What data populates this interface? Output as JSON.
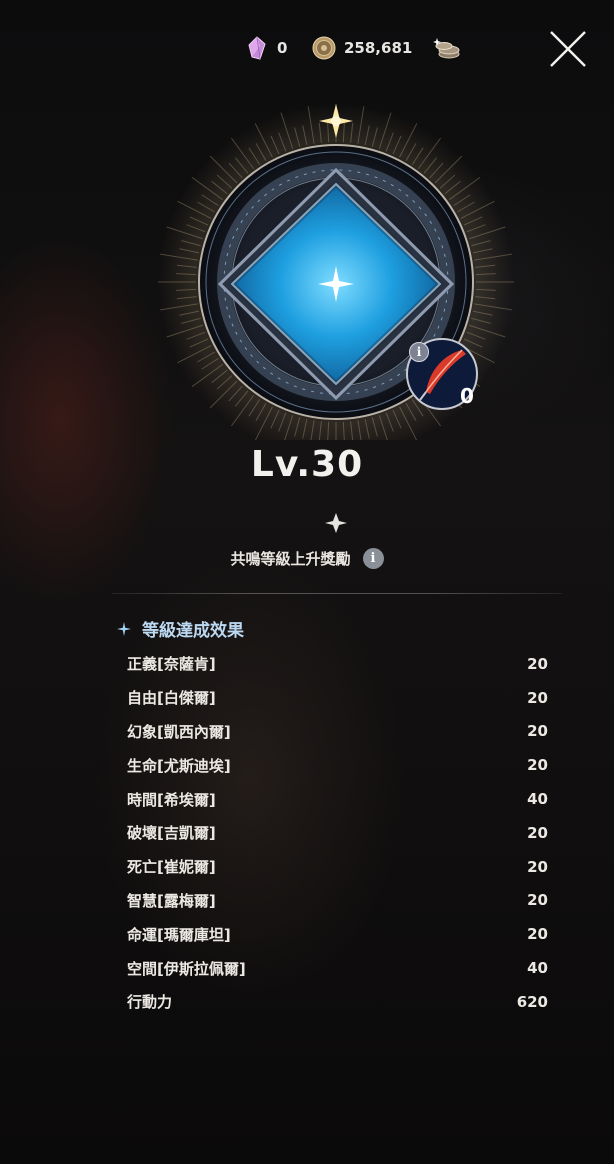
{
  "currencies": [
    {
      "icon": "crystal-icon",
      "value": "0"
    },
    {
      "icon": "coin-icon",
      "value": "258,681"
    },
    {
      "icon": "coin-stack-icon"
    }
  ],
  "emblem": {
    "feather_count": "0",
    "info_glyph": "i"
  },
  "level": "Lv.30",
  "reward": {
    "label": "共鳴等級上升獎勵",
    "info_glyph": "i"
  },
  "effects_title": "等級達成效果",
  "effects": [
    {
      "name": "正義[奈薩肯]",
      "value": "20"
    },
    {
      "name": "自由[白傑爾]",
      "value": "20"
    },
    {
      "name": "幻象[凱西內爾]",
      "value": "20"
    },
    {
      "name": "生命[尤斯迪埃]",
      "value": "20"
    },
    {
      "name": "時間[希埃爾]",
      "value": "40"
    },
    {
      "name": "破壞[吉凱爾]",
      "value": "20"
    },
    {
      "name": "死亡[崔妮爾]",
      "value": "20"
    },
    {
      "name": "智慧[露梅爾]",
      "value": "20"
    },
    {
      "name": "命運[瑪爾庫坦]",
      "value": "20"
    },
    {
      "name": "空間[伊斯拉佩爾]",
      "value": "40"
    },
    {
      "name": "行動力",
      "value": "620"
    }
  ],
  "colors": {
    "accent_blue": "#2aa8e8",
    "section_title": "#bcd9f2",
    "feather_red": "#d93a2a"
  }
}
